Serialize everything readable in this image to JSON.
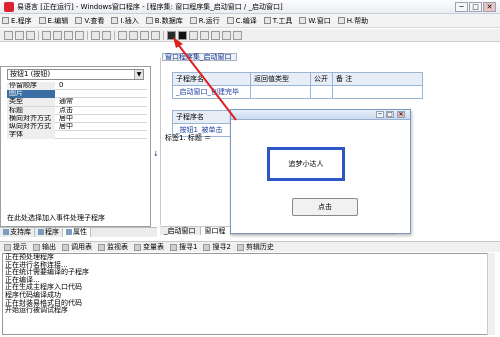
{
  "title_bar": {
    "title": "易语言 [正在运行] - Windows窗口程序 - [程序集: 窗口程序集_启动窗口 / _启动窗口]",
    "minimize": "─",
    "restore": "□",
    "close": "✕"
  },
  "menu": {
    "items": [
      "E.程序",
      "E.编辑",
      "V.查看",
      "I.插入",
      "B.数据库",
      "R.运行",
      "C.编译",
      "T.工具",
      "W.窗口",
      "H.帮助"
    ]
  },
  "left_panel": {
    "component_select": "按钮1 (按钮)",
    "properties": [
      {
        "name": "停留顺序",
        "value": "0"
      },
      {
        "name": "图片",
        "value": ""
      },
      {
        "name": "类型",
        "value": "通常"
      },
      {
        "name": "标题",
        "value": "点击"
      },
      {
        "name": "横向对齐方式",
        "value": "居中"
      },
      {
        "name": "纵向对齐方式",
        "value": "居中"
      },
      {
        "name": "字体",
        "value": ""
      }
    ],
    "description": "在此处选择加入事件处理子程序",
    "tabs": [
      "支持库",
      "程序",
      "属性"
    ]
  },
  "editor": {
    "tab_label": "窗口程序集_启动窗口",
    "table1": {
      "headers": [
        "子程序名",
        "返回值类型",
        "公开",
        "备 注"
      ],
      "row": [
        "_启动窗口_创建完毕",
        "",
        "",
        ""
      ]
    },
    "table2": {
      "headers": [
        "子程序名"
      ],
      "row": [
        "_按钮1_被单击"
      ]
    },
    "code_line": "标签1. 标题 ＝",
    "gutter_mark": "↓",
    "doc_tabs": [
      "_启动窗口",
      "窗口程"
    ]
  },
  "dialog": {
    "label_text": "追梦小达人",
    "button_text": "点击",
    "minimize": "─",
    "maximize": "□",
    "close": "✕"
  },
  "output": {
    "tabs": [
      "提示",
      "输出",
      "调用表",
      "监视表",
      "变量表",
      "搜寻1",
      "搜寻2",
      "剪辑历史"
    ],
    "lines": [
      "正在预处理程序",
      "正在进行名称连接...",
      "正在统计需要编译的子程序",
      "正在编译...",
      "正在生成主程序入口代码",
      "程序代码编译成功",
      "正在封装易格式目的代码",
      "开始运行被调试程序"
    ]
  },
  "colors": {
    "dialog_highlight": "#2d55c8",
    "annotation_arrow": "#e02020",
    "selected_property": "#3a6ea5"
  }
}
